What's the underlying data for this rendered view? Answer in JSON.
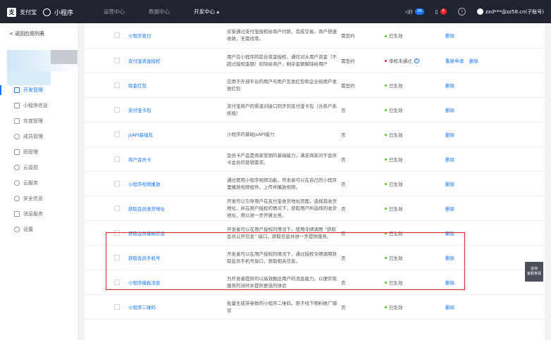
{
  "topbar": {
    "brand_logo": "支",
    "brand_text": "支付宝",
    "brand_mini": "小程序",
    "nav": [
      {
        "label": "运营中心"
      },
      {
        "label": "数据中心"
      },
      {
        "label": "开发中心 ▴"
      }
    ],
    "speaker_badge": "38",
    "msg_badge": "5",
    "help_icon": "?",
    "account": "zxd***@zz58.cn(子账号)"
  },
  "sidebar": {
    "back": "< 返回应用列表",
    "items": [
      {
        "label": "开发管理",
        "icon": "code-icon"
      },
      {
        "label": "小程序信息",
        "icon": "grid-icon"
      },
      {
        "label": "灰度管理",
        "icon": "gray-icon"
      },
      {
        "label": "成员管理",
        "icon": "member-icon"
      },
      {
        "label": "码管理",
        "icon": "qrcode-icon"
      },
      {
        "label": "云监控",
        "icon": "cloud-icon"
      },
      {
        "label": "云服务",
        "icon": "cloud-service-icon"
      },
      {
        "label": "安全信息",
        "icon": "shield-icon"
      },
      {
        "label": "消息服务",
        "icon": "message-icon"
      },
      {
        "label": "设置",
        "icon": "gear-icon"
      }
    ]
  },
  "rows": [
    {
      "name": "小程序支付",
      "desc": "买家通过支付宝授权给商户付款，完成交易，商户快速收款，无需找零。",
      "type": "需签约",
      "status": "已生效",
      "status_color": "green",
      "ops": [
        "删除"
      ]
    },
    {
      "name": "支付宝资金授权",
      "desc": "用户在小程序的前台资金授权，通信对从用户资金（不超过授权金额）扣除给商户，剩余金额解除给用户",
      "type": "需签约",
      "status": "审核未通过",
      "status_color": "red",
      "info": "i",
      "ops": [
        "重新申请",
        "删除"
      ]
    },
    {
      "name": "现金红包",
      "desc": "应用于外部平台的用户与用户互发红包和企业给用户发放红包",
      "type": "需签约",
      "status": "已生效",
      "status_color": "green",
      "ops": [
        "删除"
      ]
    },
    {
      "name": "支付宝卡包",
      "desc": "支付宝商户的渠道对接口同步到支付宝卡包（含商户系统组）",
      "type": "否",
      "status": "已生效",
      "status_color": "green",
      "ops": [
        "删除"
      ]
    },
    {
      "name": "jsAPI基础包",
      "desc": "小程序的基础jsAPI能力",
      "type": "否",
      "status": "已生效",
      "status_color": "green",
      "ops": [
        "删除"
      ]
    },
    {
      "name": "商户会员卡",
      "desc": "会员卡产品是商家营销的基础能力，满足商家对于会员卡会员的营销需求。",
      "type": "否",
      "status": "已生效",
      "status_color": "green",
      "ops": [
        "删除"
      ]
    },
    {
      "name": "小程序视频播放",
      "desc": "通过使用小程序视频功能，开发者可以在自己的小程序里播放视频组件，上传并播放视频。",
      "type": "否",
      "status": "已生效",
      "status_color": "green",
      "ops": [
        "删除"
      ]
    },
    {
      "name": "获取会员收货地址",
      "desc": "开发可以引导用户在支付宝收货地址页面，选择其收货地址，并在用户授权的情况下，获取用户所选择的收货地址，用以进一步开展业务。",
      "type": "否",
      "status": "已生效",
      "status_color": "green",
      "ops": [
        "删除"
      ]
    },
    {
      "name": "获取会员基础信息",
      "desc": "开发者可以在用户授权的情况下，使用令牌调用 “获取会员公开信息” 接口，获取信息并进一步提供服务。",
      "type": "否",
      "status": "已生效",
      "status_color": "green",
      "ops": [
        "删除"
      ]
    },
    {
      "name": "获取会员手机号",
      "desc": "开发者可以在用户授权的情况下，通过授权令牌调用获取会员手机号接口，获取相关信息。",
      "type": "否",
      "status": "已生效",
      "status_color": "green",
      "ops": [
        "删除"
      ]
    },
    {
      "name": "小程序模板消息",
      "desc": "为开发者提供可以高效触达用户的消息能力，以便实现服务的闭环并提供更佳的体验",
      "type": "否",
      "status": "已生效",
      "status_color": "green",
      "ops": [
        "删除"
      ]
    },
    {
      "name": "小程序二维码",
      "desc": "批量生成带参数的小程序二维码，用于线下物料推广铺设",
      "type": "否",
      "status": "已生效",
      "status_color": "green",
      "ops": [
        "删除"
      ]
    }
  ],
  "float_button": {
    "line1": "咨询",
    "line2": "客服答疑"
  }
}
